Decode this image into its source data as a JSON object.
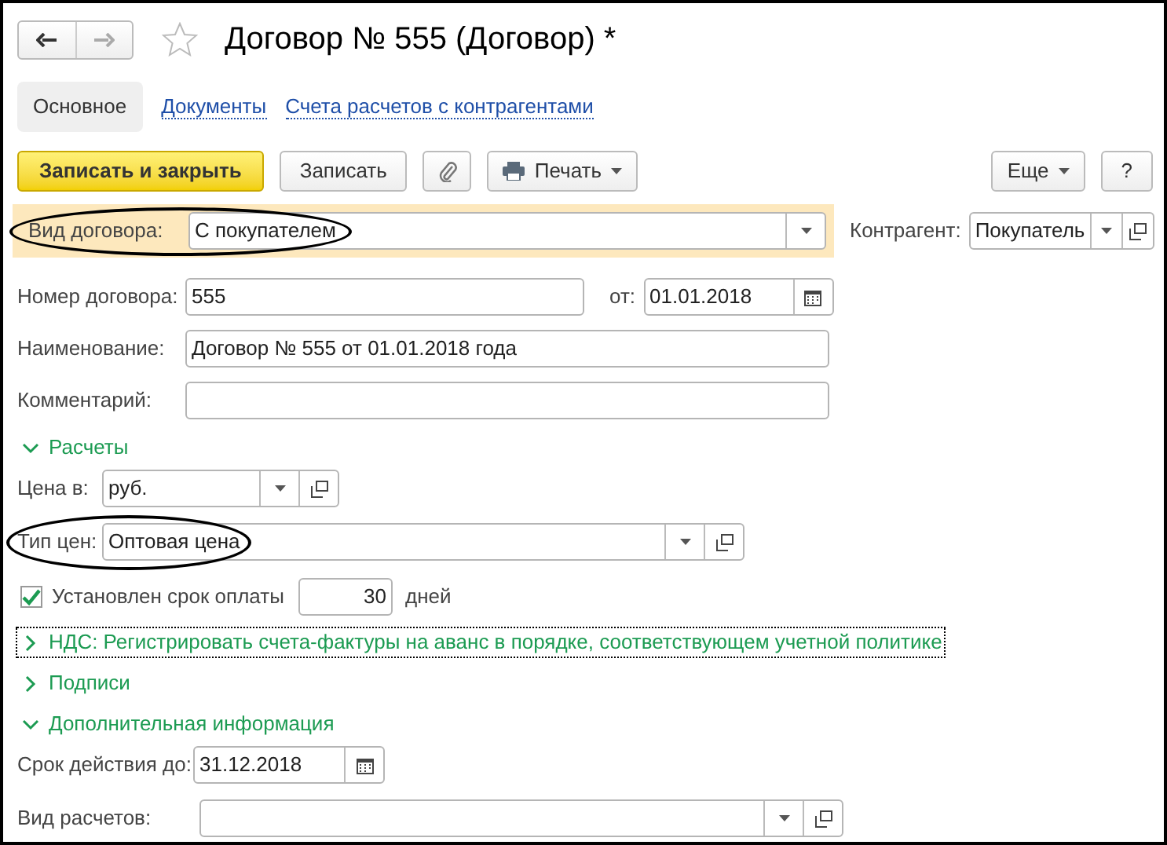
{
  "title": "Договор № 555 (Договор) *",
  "tabs": [
    {
      "label": "Основное",
      "selected": true
    },
    {
      "label": "Документы",
      "selected": false
    },
    {
      "label": "Счета расчетов с контрагентами",
      "selected": false
    }
  ],
  "toolbar": {
    "left": [
      {
        "kind": "primary",
        "label": "Записать и закрыть"
      },
      {
        "kind": "plain",
        "label": "Записать"
      },
      {
        "kind": "attach"
      },
      {
        "kind": "menu",
        "label": "Печать"
      }
    ],
    "right": [
      {
        "kind": "menu",
        "label": "Еще"
      },
      {
        "kind": "plain",
        "label": "?"
      }
    ]
  },
  "contract_type": {
    "label": "Вид договора:",
    "value": "С покупателем",
    "circled": true
  },
  "counterparty": {
    "label": "Контрагент:",
    "value": "Покупатель"
  },
  "number": {
    "label": "Номер договора:",
    "value": "555"
  },
  "date": {
    "label": "от:",
    "value": "01.01.2018"
  },
  "name": {
    "label": "Наименование:",
    "value": "Договор № 555 от 01.01.2018 года"
  },
  "comment": {
    "label": "Комментарий:"
  },
  "settlements": {
    "title": "Расчеты",
    "expanded": true,
    "price_currency": {
      "label": "Цена в:",
      "value": "руб."
    },
    "price_type": {
      "label": "Тип цен:",
      "value": "Оптовая цена",
      "circled": true
    },
    "payment_term": {
      "label": "Установлен срок оплаты",
      "checked": true,
      "value": "30",
      "unit": "дней"
    }
  },
  "vat": {
    "title": "НДС: Регистрировать счета-фактуры на аванс в порядке, соответствующем учетной политике",
    "expanded": false,
    "focused": true
  },
  "signatures": {
    "title": "Подписи",
    "expanded": false
  },
  "additional": {
    "title": "Дополнительная информация",
    "expanded": true,
    "valid_until": {
      "label": "Срок действия до:",
      "value": "31.12.2018"
    },
    "settlement_kind": {
      "label": "Вид расчетов:"
    }
  }
}
